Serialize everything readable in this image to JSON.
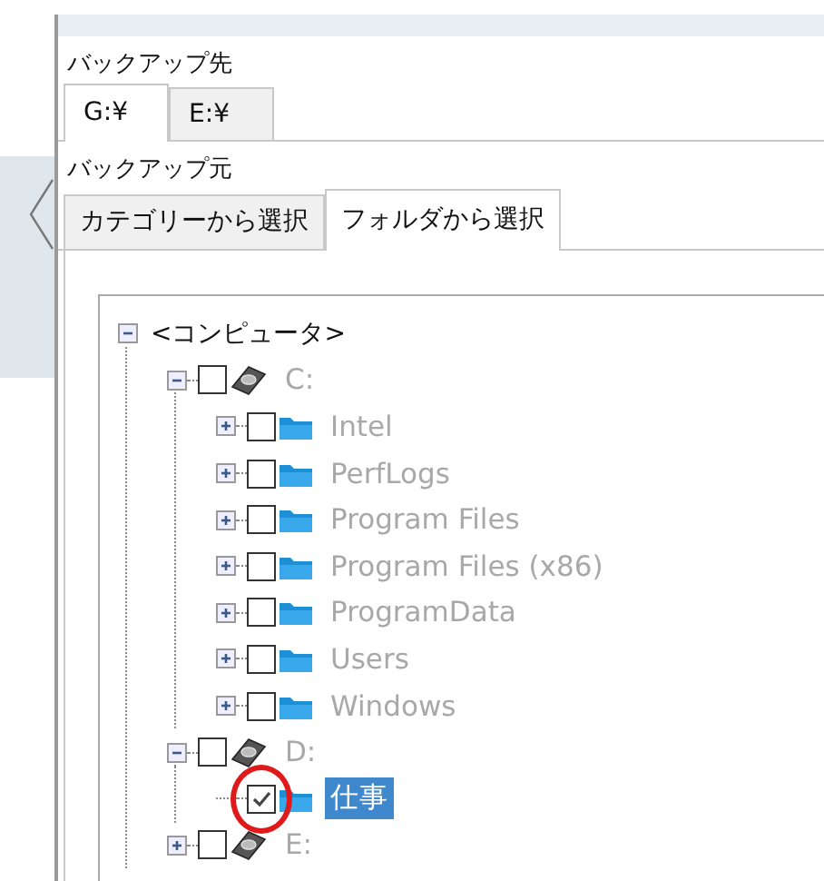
{
  "destination": {
    "label": "バックアップ先",
    "tabs": [
      {
        "label": "G:¥",
        "selected": true
      },
      {
        "label": "E:¥",
        "selected": false
      }
    ]
  },
  "source": {
    "label": "バックアップ元",
    "tabs": [
      {
        "label": "カテゴリーから選択",
        "selected": false
      },
      {
        "label": "フォルダから選択",
        "selected": true
      }
    ]
  },
  "tree": [
    {
      "label": "<コンピュータ>",
      "kind": "root",
      "expanded": true,
      "children": [
        {
          "label": "C:",
          "kind": "drive",
          "expanded": true,
          "checked": false,
          "disabled": true,
          "selected": false,
          "children": [
            {
              "label": "Intel",
              "kind": "folder",
              "expanded": false,
              "checked": false,
              "disabled": true,
              "selected": false
            },
            {
              "label": "PerfLogs",
              "kind": "folder",
              "expanded": false,
              "checked": false,
              "disabled": true,
              "selected": false
            },
            {
              "label": "Program Files",
              "kind": "folder",
              "expanded": false,
              "checked": false,
              "disabled": true,
              "selected": false
            },
            {
              "label": "Program Files (x86)",
              "kind": "folder",
              "expanded": false,
              "checked": false,
              "disabled": true,
              "selected": false
            },
            {
              "label": "ProgramData",
              "kind": "folder",
              "expanded": false,
              "checked": false,
              "disabled": true,
              "selected": false
            },
            {
              "label": "Users",
              "kind": "folder",
              "expanded": false,
              "checked": false,
              "disabled": true,
              "selected": false
            },
            {
              "label": "Windows",
              "kind": "folder",
              "expanded": false,
              "checked": false,
              "disabled": true,
              "selected": false
            }
          ]
        },
        {
          "label": "D:",
          "kind": "drive",
          "expanded": true,
          "checked": false,
          "disabled": true,
          "selected": false,
          "children": [
            {
              "label": "仕事",
              "kind": "folder",
              "checked": true,
              "disabled": false,
              "selected": true
            }
          ]
        },
        {
          "label": "E:",
          "kind": "drive",
          "expanded": false,
          "checked": false,
          "disabled": true,
          "selected": false
        }
      ]
    }
  ]
}
